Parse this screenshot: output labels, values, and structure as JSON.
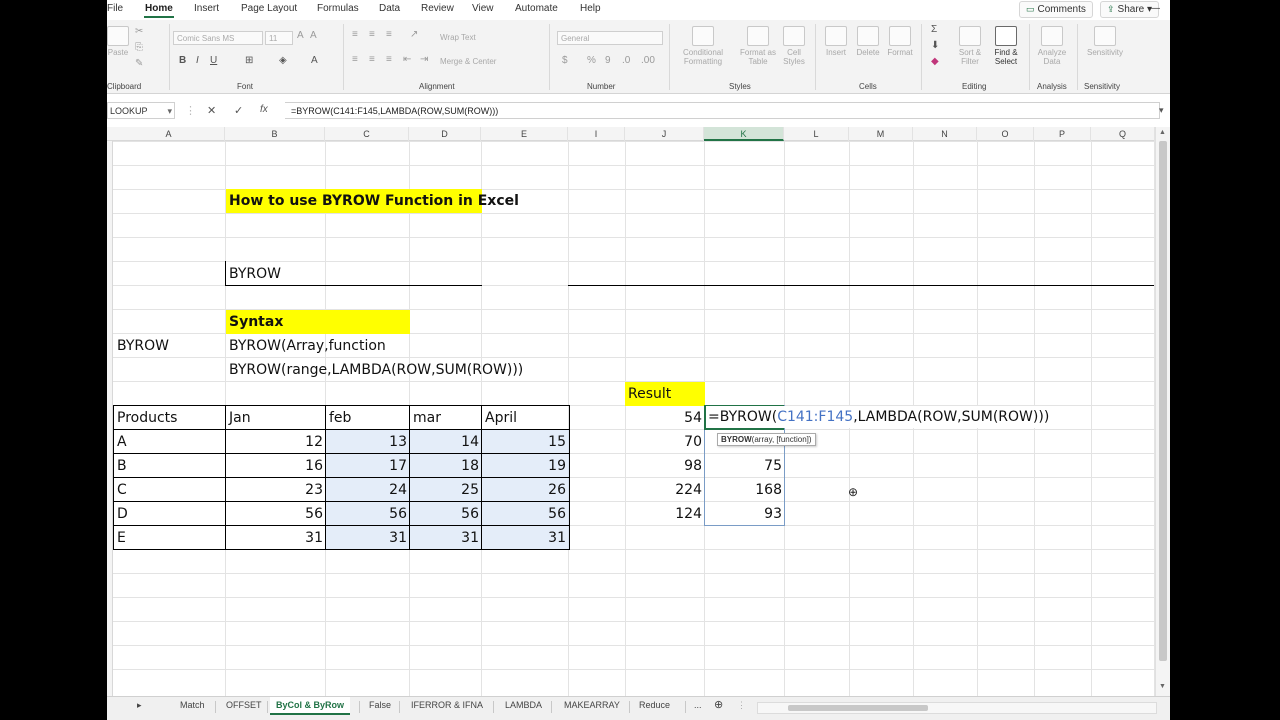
{
  "ribbon_tabs": [
    "File",
    "Home",
    "Insert",
    "Page Layout",
    "Formulas",
    "Data",
    "Review",
    "View",
    "Automate",
    "Help"
  ],
  "active_tab": "Home",
  "top_buttons": {
    "comments": "Comments",
    "share": "Share"
  },
  "ribbon": {
    "paste": "Paste",
    "font_name": "Comic Sans MS",
    "font_size": "11",
    "wrap_text": "Wrap Text",
    "merge_center": "Merge & Center",
    "number_format": "General",
    "conditional_formatting": "Conditional Formatting",
    "format_as_table": "Format as Table",
    "cell_styles": "Cell Styles",
    "insert": "Insert",
    "delete": "Delete",
    "format": "Format",
    "sort_filter": "Sort & Filter",
    "find_select": "Find & Select",
    "analyze_data": "Analyze Data",
    "sensitivity": "Sensitivity",
    "groups": [
      "Clipboard",
      "Font",
      "Alignment",
      "Number",
      "Styles",
      "Cells",
      "Editing",
      "Analysis",
      "Sensitivity"
    ]
  },
  "formula_bar": {
    "name_box": "LOOKUP",
    "fx": "fx",
    "formula": "=BYROW(C141:F145,LAMBDA(ROW,SUM(ROW)))"
  },
  "columns": [
    "A",
    "B",
    "C",
    "D",
    "E",
    "I",
    "J",
    "K",
    "L",
    "M",
    "N",
    "O",
    "P",
    "Q"
  ],
  "selected_column": "K",
  "content": {
    "title": "How to use BYROW Function in Excel",
    "byrow_label": "BYROW",
    "syntax_label": "Syntax",
    "byrow_side": "BYROW",
    "syntax_1": "BYROW(Array,function",
    "syntax_2": "BYROW(range,LAMBDA(ROW,SUM(ROW)))",
    "result_label": "Result"
  },
  "table": {
    "headers": [
      "Products",
      "Jan",
      "feb",
      "mar",
      "April"
    ],
    "rows": [
      {
        "product": "A",
        "values": [
          "12",
          "13",
          "14",
          "15"
        ]
      },
      {
        "product": "B",
        "values": [
          "16",
          "17",
          "18",
          "19"
        ]
      },
      {
        "product": "C",
        "values": [
          "23",
          "24",
          "25",
          "26"
        ]
      },
      {
        "product": "D",
        "values": [
          "56",
          "56",
          "56",
          "56"
        ]
      },
      {
        "product": "E",
        "values": [
          "31",
          "31",
          "31",
          "31"
        ]
      }
    ]
  },
  "results_j": [
    "54",
    "70",
    "98",
    "224",
    "124"
  ],
  "results_k": [
    "75",
    "168",
    "93"
  ],
  "editing": {
    "prefix": "=BYROW(",
    "ref": "C141:F145",
    "suffix": ",LAMBDA(ROW,SUM(ROW)))",
    "tooltip_func": "BYROW",
    "tooltip_args": "(array, [function])"
  },
  "sheet_tabs": [
    "Match",
    "OFFSET",
    "ByCol & ByRow",
    "False",
    "IFERROR & IFNA",
    "LAMBDA",
    "MAKEARRAY",
    "Reduce",
    "..."
  ],
  "active_sheet": "ByCol & ByRow"
}
